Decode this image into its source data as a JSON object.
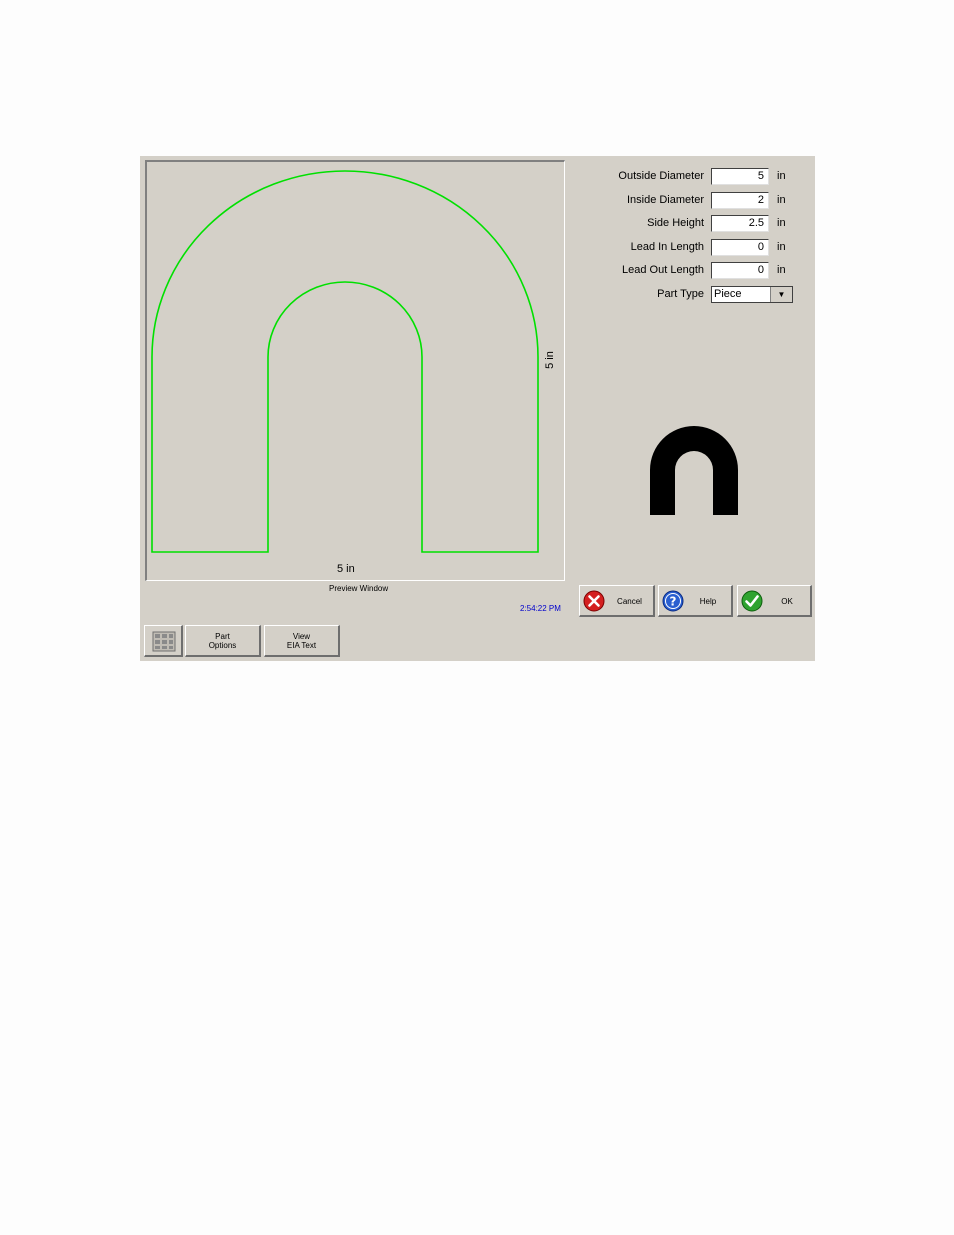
{
  "preview": {
    "caption": "Preview Window",
    "width_dimension": "5 in",
    "height_dimension": "5 in",
    "outline_color": "#00e000"
  },
  "form": {
    "outside_diameter": {
      "label": "Outside Diameter",
      "value": "5",
      "unit": "in"
    },
    "inside_diameter": {
      "label": "Inside Diameter",
      "value": "2",
      "unit": "in"
    },
    "side_height": {
      "label": "Side Height",
      "value": "2.5",
      "unit": "in"
    },
    "lead_in_length": {
      "label": "Lead In Length",
      "value": "0",
      "unit": "in"
    },
    "lead_out_length": {
      "label": "Lead Out Length",
      "value": "0",
      "unit": "in"
    },
    "part_type": {
      "label": "Part Type",
      "value": "Piece"
    }
  },
  "buttons": {
    "cancel": "Cancel",
    "help": "Help",
    "ok": "OK",
    "part_options_line1": "Part",
    "part_options_line2": "Options",
    "view_eia_line1": "View",
    "view_eia_line2": "EIA Text"
  },
  "status": {
    "clock": "2:54:22 PM"
  },
  "icons": {
    "cancel": "red-x-circle-icon",
    "help": "question-circle-icon",
    "ok": "green-checkmark-icon",
    "keypad": "keypad-icon",
    "shape": "u-shape-thumbnail-icon"
  }
}
